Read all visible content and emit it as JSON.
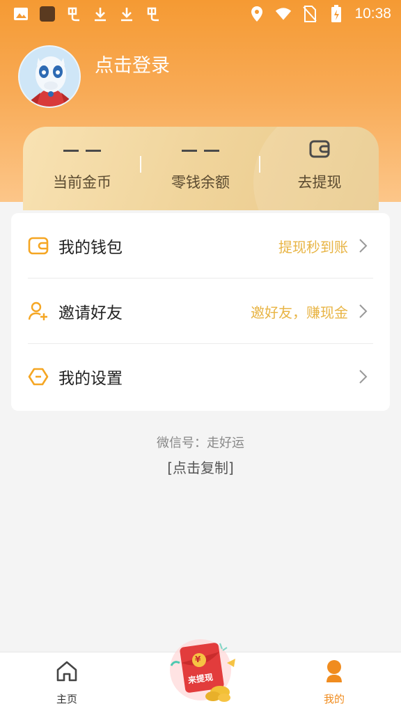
{
  "status_bar": {
    "time": "10:38",
    "left_icons": [
      "image-icon",
      "app-icon",
      "notification-icon",
      "download-icon",
      "download-icon",
      "notification-icon"
    ],
    "right_icons": [
      "location-icon",
      "wifi-icon",
      "no-sim-icon",
      "battery-charging-icon"
    ]
  },
  "profile": {
    "login_text": "点击登录"
  },
  "wallet": {
    "coins_value": "— —",
    "coins_label": "当前金币",
    "balance_value": "— —",
    "balance_label": "零钱余额",
    "withdraw_label": "去提现"
  },
  "menu": [
    {
      "title": "我的钱包",
      "subtitle": "提现秒到账",
      "icon": "wallet-icon"
    },
    {
      "title": "邀请好友",
      "subtitle": "邀好友，赚现金",
      "icon": "add-user-icon"
    },
    {
      "title": "我的设置",
      "subtitle": "",
      "icon": "settings-hexagon-icon"
    }
  ],
  "footer": {
    "wechat": "微信号：走好运",
    "copy": "[点击复制]"
  },
  "bottom_nav": {
    "home_label": "主页",
    "promo_label": "来提现",
    "promo_currency": "¥",
    "mine_label": "我的"
  },
  "colors": {
    "header_top": "#f59a33",
    "header_bottom": "#fcc689",
    "accent": "#f08c1f",
    "subtitle": "#e8b444",
    "card_gold": "#f0d49b"
  }
}
